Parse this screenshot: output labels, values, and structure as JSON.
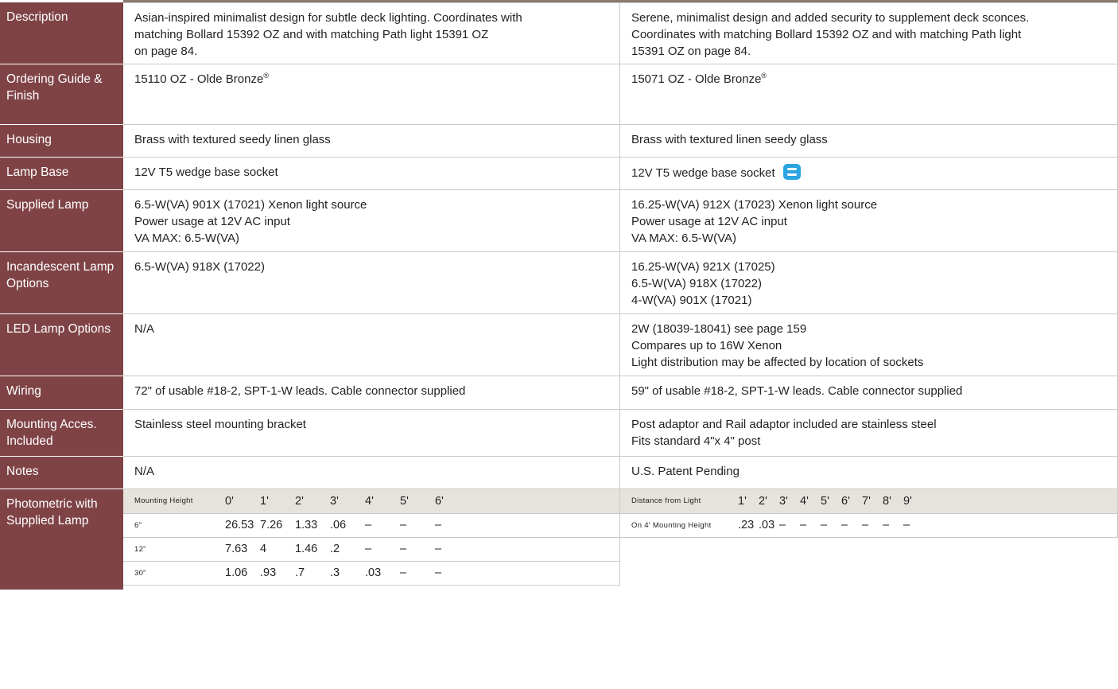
{
  "rows": [
    {
      "label": "Description",
      "col1": [
        "Asian-inspired minimalist design for subtle deck lighting. Coordinates with",
        "matching Bollard 15392 OZ and with matching Path light 15391 OZ",
        "on page 84."
      ],
      "col2": [
        "Serene, minimalist design and added security to supplement deck sconces.",
        "Coordinates with matching Bollard 15392 OZ and with matching Path light",
        "15391 OZ on page 84."
      ]
    },
    {
      "label": "Ordering Guide & Finish",
      "col1": "15110 OZ - Olde Bronze",
      "col2": "15071 OZ - Olde Bronze",
      "reg": "®"
    },
    {
      "label": "Housing",
      "col1": "Brass with textured seedy linen glass",
      "col2": "Brass with textured linen seedy glass"
    },
    {
      "label": "Lamp Base",
      "col1": "12V  T5 wedge base socket",
      "col2": "12V  T5 wedge base socket"
    },
    {
      "label": "Supplied Lamp",
      "col1": [
        "6.5-W(VA) 901X (17021) Xenon light source",
        "Power usage at 12V AC input",
        "VA MAX: 6.5-W(VA)"
      ],
      "col2": [
        "16.25-W(VA) 912X (17023) Xenon light source",
        "Power usage at 12V AC input",
        "VA MAX: 6.5-W(VA)"
      ]
    },
    {
      "label": "Incandescent Lamp Options",
      "col1": [
        "6.5-W(VA) 918X (17022)"
      ],
      "col2": [
        "16.25-W(VA) 921X (17025)",
        "6.5-W(VA) 918X (17022)",
        "4-W(VA) 901X (17021)"
      ]
    },
    {
      "label": "LED Lamp Options",
      "col1": [
        "N/A"
      ],
      "col2": [
        "2W (18039-18041) see page 159",
        "Compares up to 16W Xenon",
        "Light distribution may be affected by location of sockets"
      ]
    },
    {
      "label": "Wiring",
      "col1": "72\" of usable #18-2, SPT-1-W leads. Cable connector supplied",
      "col2": "59\" of usable #18-2, SPT-1-W leads. Cable connector supplied"
    },
    {
      "label": "Mounting Acces. Included",
      "col1": [
        "Stainless steel mounting bracket"
      ],
      "col2": [
        "Post adaptor and Rail adaptor included are stainless steel",
        "Fits standard 4\"x 4\" post"
      ]
    },
    {
      "label": "Notes",
      "col1": "N/A",
      "col2": "U.S. Patent Pending"
    }
  ],
  "photometric": {
    "label": "Photometric with Supplied Lamp",
    "left": {
      "header_label": "Mounting Height",
      "columns": [
        "0'",
        "1'",
        "2'",
        "3'",
        "4'",
        "5'",
        "6'"
      ],
      "rows": [
        {
          "label": "6\"",
          "values": [
            "26.53",
            "7.26",
            "1.33",
            ".06",
            "–",
            "–",
            "–"
          ]
        },
        {
          "label": "12\"",
          "values": [
            "7.63",
            "4",
            "1.46",
            ".2",
            "–",
            "–",
            "–"
          ]
        },
        {
          "label": "30\"",
          "values": [
            "1.06",
            ".93",
            ".7",
            ".3",
            ".03",
            "–",
            "–"
          ]
        }
      ]
    },
    "right": {
      "header_label": "Distance from Light",
      "columns": [
        "1'",
        "2'",
        "3'",
        "4'",
        "5'",
        "6'",
        "7'",
        "8'",
        "9'"
      ],
      "rows": [
        {
          "label": "On 4' Mounting Height",
          "values": [
            ".23",
            ".03",
            "–",
            "–",
            "–",
            "–",
            "–",
            "–",
            "–"
          ]
        }
      ]
    }
  },
  "colors": {
    "label_bg": "#7f4346",
    "header_bg": "#e6e2dc",
    "icon": "#2aa4e0"
  },
  "icons": {
    "lamp_base_col2": "b-icon"
  }
}
